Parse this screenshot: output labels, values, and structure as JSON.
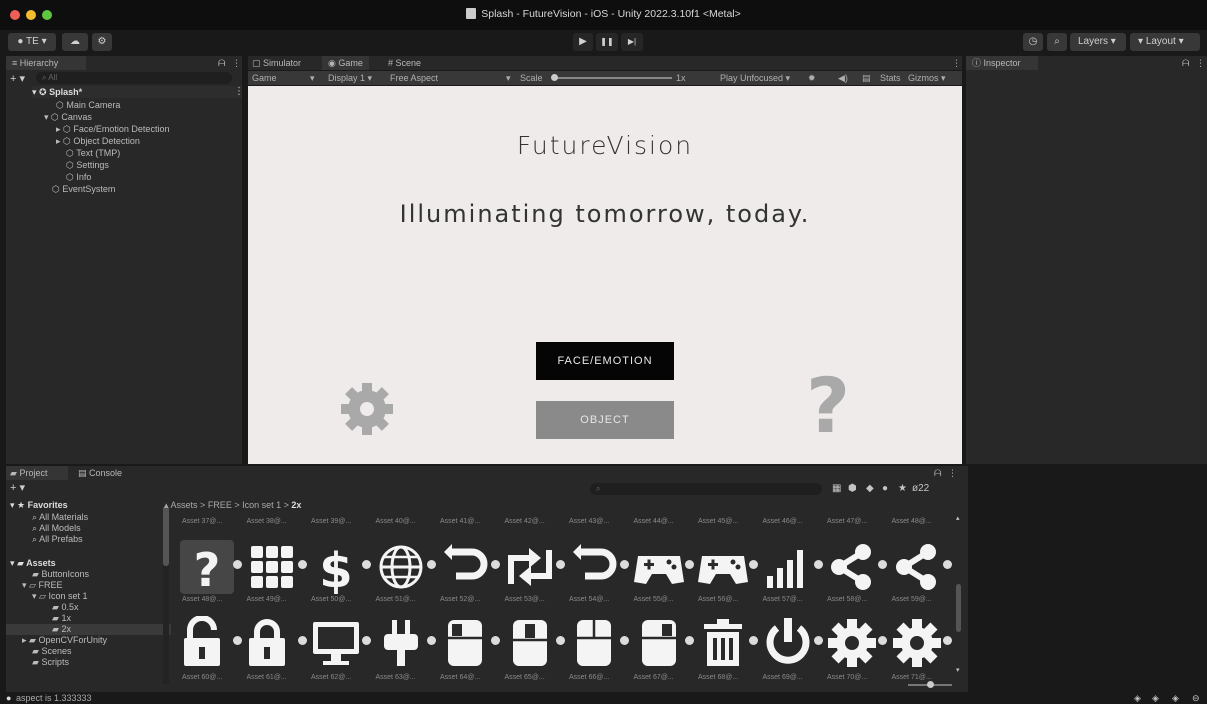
{
  "window": {
    "title": "Splash - FutureVision - iOS - Unity 2022.3.10f1 <Metal>"
  },
  "toolbar": {
    "account_label": "TE",
    "play": "▶",
    "pause": "❚❚",
    "step": "▶|",
    "layers_label": "Layers",
    "layout_label": "Layout"
  },
  "hierarchy": {
    "tab": "Hierarchy",
    "search_placeholder": "All",
    "items": [
      "Splash*",
      "Main Camera",
      "Canvas",
      "Face/Emotion Detection",
      "Object Detection",
      "Text (TMP)",
      "Settings",
      "Info",
      "EventSystem"
    ]
  },
  "views": {
    "tabs": [
      "Simulator",
      "Game",
      "Scene"
    ],
    "game_dropdown": "Game",
    "display": "Display 1",
    "aspect": "Free Aspect",
    "scale_label": "Scale",
    "scale_value": "1x",
    "play_mode": "Play Unfocused",
    "stats": "Stats",
    "gizmos": "Gizmos"
  },
  "game": {
    "title": "FutureVision",
    "tagline": "Illuminating tomorrow, today.",
    "face_button": "FACE/EMOTION",
    "object_button": "OBJECT",
    "help_glyph": "?"
  },
  "inspector": {
    "tab": "Inspector"
  },
  "project": {
    "tabs": [
      "Project",
      "Console"
    ],
    "breadcrumb": [
      "Assets",
      "FREE",
      "Icon set 1",
      "2x"
    ],
    "hidden_count": "22",
    "favorites_label": "Favorites",
    "favorites": [
      "All Materials",
      "All Models",
      "All Prefabs"
    ],
    "assets_label": "Assets",
    "folders": [
      "ButtonIcons",
      "FREE",
      "Icon set 1",
      "0.5x",
      "1x",
      "2x",
      "OpenCVForUnity",
      "Scenes",
      "Scripts"
    ],
    "row0_labels": [
      "Asset 37@...",
      "Asset 38@...",
      "Asset 39@...",
      "Asset 40@...",
      "Asset 41@...",
      "Asset 42@...",
      "Asset 43@...",
      "Asset 44@...",
      "Asset 45@...",
      "Asset 46@...",
      "Asset 47@...",
      "Asset 48@..."
    ],
    "row1_labels": [
      "Asset 48@...",
      "Asset 49@...",
      "Asset 50@...",
      "Asset 51@...",
      "Asset 52@...",
      "Asset 53@...",
      "Asset 54@...",
      "Asset 55@...",
      "Asset 56@...",
      "Asset 57@...",
      "Asset 58@...",
      "Asset 59@..."
    ],
    "row2_labels": [
      "Asset 60@...",
      "Asset 61@...",
      "Asset 62@...",
      "Asset 63@...",
      "Asset 64@...",
      "Asset 65@...",
      "Asset 66@...",
      "Asset 67@...",
      "Asset 68@...",
      "Asset 69@...",
      "Asset 70@...",
      "Asset 71@..."
    ],
    "row1_icons": [
      "question-icon",
      "grid-icon",
      "dollar-icon",
      "globe-icon",
      "undo-icon",
      "swap-arrows-icon",
      "undo-icon",
      "gamepad-icon",
      "gamepad-icon",
      "signal-bars-icon",
      "share-icon",
      "share-icon"
    ],
    "row2_icons": [
      "unlocked-icon",
      "locked-icon",
      "monitor-icon",
      "plug-icon",
      "mouse-left-icon",
      "mouse-middle-icon",
      "mouse-icon",
      "mouse-right-icon",
      "trash-icon",
      "power-icon",
      "gear-icon",
      "gear-icon"
    ]
  },
  "status": {
    "message": "aspect is 1.333333"
  }
}
